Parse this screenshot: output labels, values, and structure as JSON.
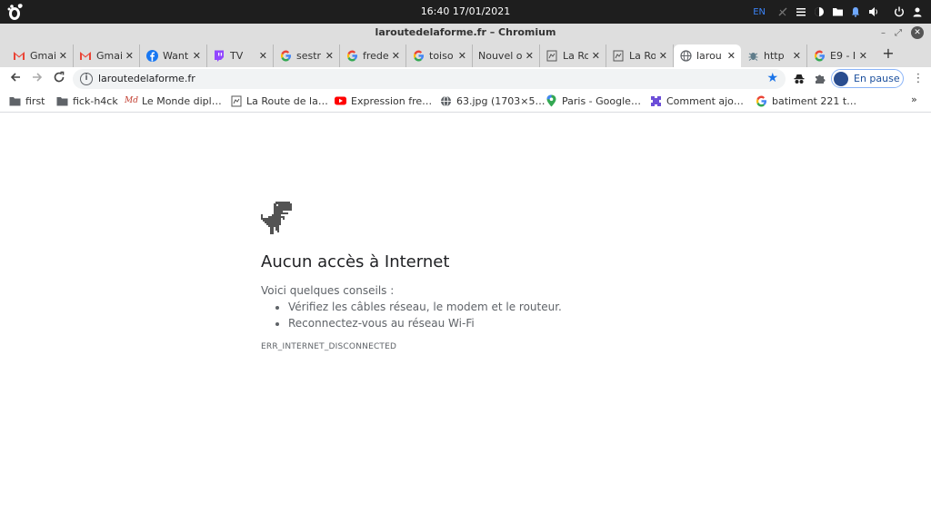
{
  "system": {
    "clock": "16:40 17/01/2021",
    "lang": "EN"
  },
  "window": {
    "title": "laroutedelaforme.fr – Chromium"
  },
  "tabs": [
    {
      "label": "Gmai",
      "icon": "gmail-icon"
    },
    {
      "label": "Gmai",
      "icon": "gmail-icon"
    },
    {
      "label": "Want",
      "icon": "facebook-icon"
    },
    {
      "label": "TV",
      "icon": "twitch-icon"
    },
    {
      "label": "sestr",
      "icon": "google-icon"
    },
    {
      "label": "frede",
      "icon": "google-icon"
    },
    {
      "label": "toiso",
      "icon": "google-icon"
    },
    {
      "label": "Nouvel o",
      "icon": ""
    },
    {
      "label": "La Ro",
      "icon": "page-icon"
    },
    {
      "label": "La Ro",
      "icon": "page-icon"
    },
    {
      "label": "larou",
      "icon": "globe-icon",
      "active": true
    },
    {
      "label": "http",
      "icon": "bug-icon"
    },
    {
      "label": "E9 - I",
      "icon": "google-icon"
    }
  ],
  "toolbar": {
    "url": "laroutedelaforme.fr",
    "profile_label": "En pause"
  },
  "bookmarks": [
    {
      "label": "first",
      "icon": "folder-icon"
    },
    {
      "label": "fick-h4ck",
      "icon": "folder-icon"
    },
    {
      "label": "Le Monde dipl…",
      "icon": "md-icon"
    },
    {
      "label": "La Route de la…",
      "icon": "page-icon"
    },
    {
      "label": "Expression fre…",
      "icon": "youtube-icon"
    },
    {
      "label": "63.jpg (1703×5…",
      "icon": "globe-icon"
    },
    {
      "label": "Paris - Google…",
      "icon": "maps-icon"
    },
    {
      "label": "Comment ajo…",
      "icon": "puzzle-icon"
    },
    {
      "label": "batiment 221 t…",
      "icon": "google-icon"
    }
  ],
  "bookmarks_more": "»",
  "error": {
    "title": "Aucun accès à Internet",
    "hint": "Voici quelques conseils :",
    "tips": [
      "Vérifiez les câbles réseau, le modem et le routeur.",
      "Reconnectez-vous au réseau Wi-Fi"
    ],
    "code": "ERR_INTERNET_DISCONNECTED"
  },
  "colors": {
    "accent": "#1a73e8",
    "text": "#202124",
    "secondary": "#5f6368"
  }
}
